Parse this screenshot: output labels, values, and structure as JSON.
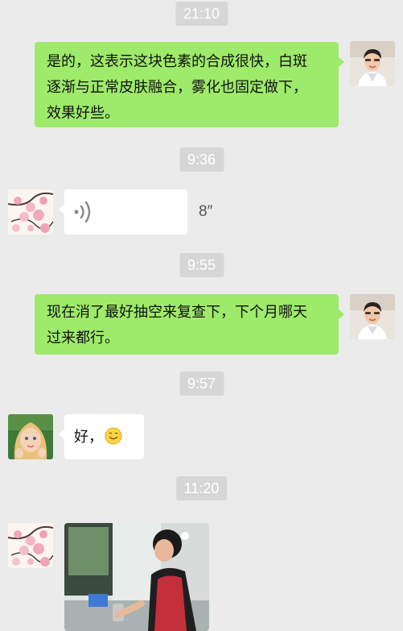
{
  "messages": [
    {
      "type": "time",
      "text": "21:10"
    },
    {
      "type": "text",
      "side": "right",
      "text": "是的，这表示这块色素的合成很快，白斑逐渐与正常皮肤融合，雾化也固定做下，效果好些。",
      "lines": [
        "是的，这表示这块色素的合成很快，白斑",
        "逐渐与正常皮肤融合，雾化也固定做下，",
        "效果好些。"
      ]
    },
    {
      "type": "time",
      "text": "9:36"
    },
    {
      "type": "voice",
      "side": "left",
      "duration": "8″"
    },
    {
      "type": "time",
      "text": "9:55"
    },
    {
      "type": "text",
      "side": "right",
      "lines": [
        "现在消了最好抽空来复查下，下个月哪天",
        "过来都行。"
      ]
    },
    {
      "type": "time",
      "text": "9:57"
    },
    {
      "type": "text",
      "side": "left",
      "text": "好，",
      "emoji": "smile-emoji"
    },
    {
      "type": "time",
      "text": "11:20"
    },
    {
      "type": "image",
      "side": "left"
    }
  ],
  "colors": {
    "background": "#ebebeb",
    "sent_bubble": "#9eea6a",
    "received_bubble": "#ffffff",
    "timestamp_bg": "#d6d6d6"
  },
  "avatars": {
    "doctor": "doctor-avatar",
    "patient_flower": "flower-avatar",
    "patient_child": "child-avatar"
  }
}
